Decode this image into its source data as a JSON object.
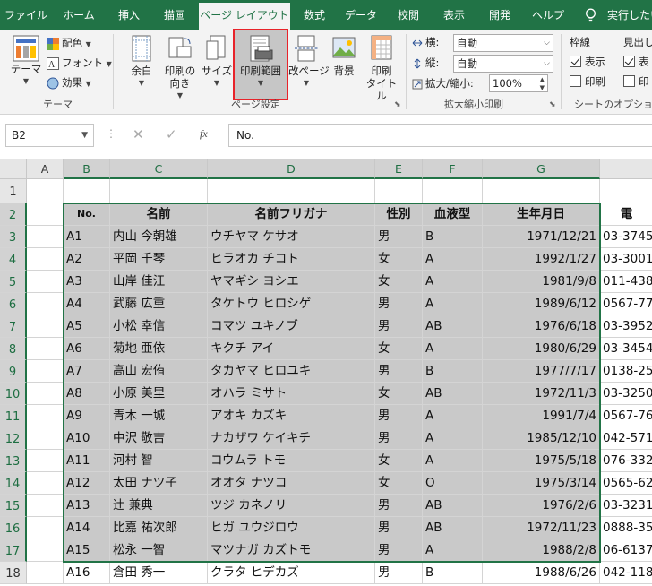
{
  "tabs": [
    {
      "label": "ファイル"
    },
    {
      "label": "ホーム"
    },
    {
      "label": "挿入"
    },
    {
      "label": "描画"
    },
    {
      "label": "ページ レイアウト",
      "active": true
    },
    {
      "label": "数式"
    },
    {
      "label": "データ"
    },
    {
      "label": "校閲"
    },
    {
      "label": "表示"
    },
    {
      "label": "開発"
    },
    {
      "label": "ヘルプ"
    },
    {
      "label": "実行したい"
    }
  ],
  "ribbon": {
    "theme": {
      "btn": "テーマ",
      "colors": "配色",
      "fonts": "フォント",
      "effects": "効果",
      "group": "テーマ"
    },
    "page_setup": {
      "margins": "余白",
      "orientation": "印刷の\n向き",
      "size": "サイズ",
      "print_area": "印刷範囲",
      "breaks": "改ページ",
      "background": "背景",
      "print_titles": "印刷\nタイトル",
      "group": "ページ設定"
    },
    "scale": {
      "width_label": "横:",
      "width_value": "自動",
      "height_label": "縦:",
      "height_value": "自動",
      "scale_label": "拡大/縮小:",
      "scale_value": "100%",
      "group": "拡大縮小印刷"
    },
    "sheet_options": {
      "gridlines": "枠線",
      "headings": "見出し",
      "view": "表示",
      "print": "印刷",
      "view2": "表",
      "print2": "印",
      "group": "シートのオプション"
    }
  },
  "formula_bar": {
    "name_box": "B2",
    "fx": "fx",
    "content": "No."
  },
  "accent": "#217346",
  "columns": [
    "A",
    "B",
    "C",
    "D",
    "E",
    "F",
    "G"
  ],
  "rows": [
    "1",
    "2",
    "3",
    "4",
    "5",
    "6",
    "7",
    "8",
    "9",
    "10",
    "11",
    "12",
    "13",
    "14",
    "15",
    "16",
    "17",
    "18"
  ],
  "table": {
    "headers": [
      "No.",
      "名前",
      "名前フリガナ",
      "性別",
      "血液型",
      "生年月日",
      "電"
    ],
    "records": [
      [
        "A1",
        "内山 今朝雄",
        "ウチヤマ ケサオ",
        "男",
        "B",
        "1971/12/21",
        "03-3745"
      ],
      [
        "A2",
        "平岡 千琴",
        "ヒラオカ チコト",
        "女",
        "A",
        "1992/1/27",
        "03-3001"
      ],
      [
        "A3",
        "山岸 佳江",
        "ヤマギシ ヨシエ",
        "女",
        "A",
        "1981/9/8",
        "011-438"
      ],
      [
        "A4",
        "武藤 広重",
        "タケトウ ヒロシゲ",
        "男",
        "A",
        "1989/6/12",
        "0567-77"
      ],
      [
        "A5",
        "小松 幸信",
        "コマツ ユキノブ",
        "男",
        "AB",
        "1976/6/18",
        "03-3952"
      ],
      [
        "A6",
        "菊地 亜依",
        "キクチ アイ",
        "女",
        "A",
        "1980/6/29",
        "03-3454"
      ],
      [
        "A7",
        "高山 宏侑",
        "タカヤマ ヒロユキ",
        "男",
        "B",
        "1977/7/17",
        "0138-25"
      ],
      [
        "A8",
        "小原 美里",
        "オハラ ミサト",
        "女",
        "AB",
        "1972/11/3",
        "03-3250"
      ],
      [
        "A9",
        "青木 一城",
        "アオキ カズキ",
        "男",
        "A",
        "1991/7/4",
        "0567-76"
      ],
      [
        "A10",
        "中沢 敬吉",
        "ナカザワ ケイキチ",
        "男",
        "A",
        "1985/12/10",
        "042-571"
      ],
      [
        "A11",
        "河村 智",
        "コウムラ トモ",
        "女",
        "A",
        "1975/5/18",
        "076-332"
      ],
      [
        "A12",
        "太田 ナツ子",
        "オオタ ナツコ",
        "女",
        "O",
        "1975/3/14",
        "0565-62"
      ],
      [
        "A13",
        "辻 兼典",
        "ツジ カネノリ",
        "男",
        "AB",
        "1976/2/6",
        "03-3231"
      ],
      [
        "A14",
        "比嘉 祐次郎",
        "ヒガ ユウジロウ",
        "男",
        "AB",
        "1972/11/23",
        "0888-35"
      ],
      [
        "A15",
        "松永 一智",
        "マツナガ カズトモ",
        "男",
        "A",
        "1988/2/8",
        "06-6137"
      ],
      [
        "A16",
        "倉田 秀一",
        "クラタ ヒデカズ",
        "男",
        "B",
        "1988/6/26",
        "042-118"
      ]
    ]
  }
}
